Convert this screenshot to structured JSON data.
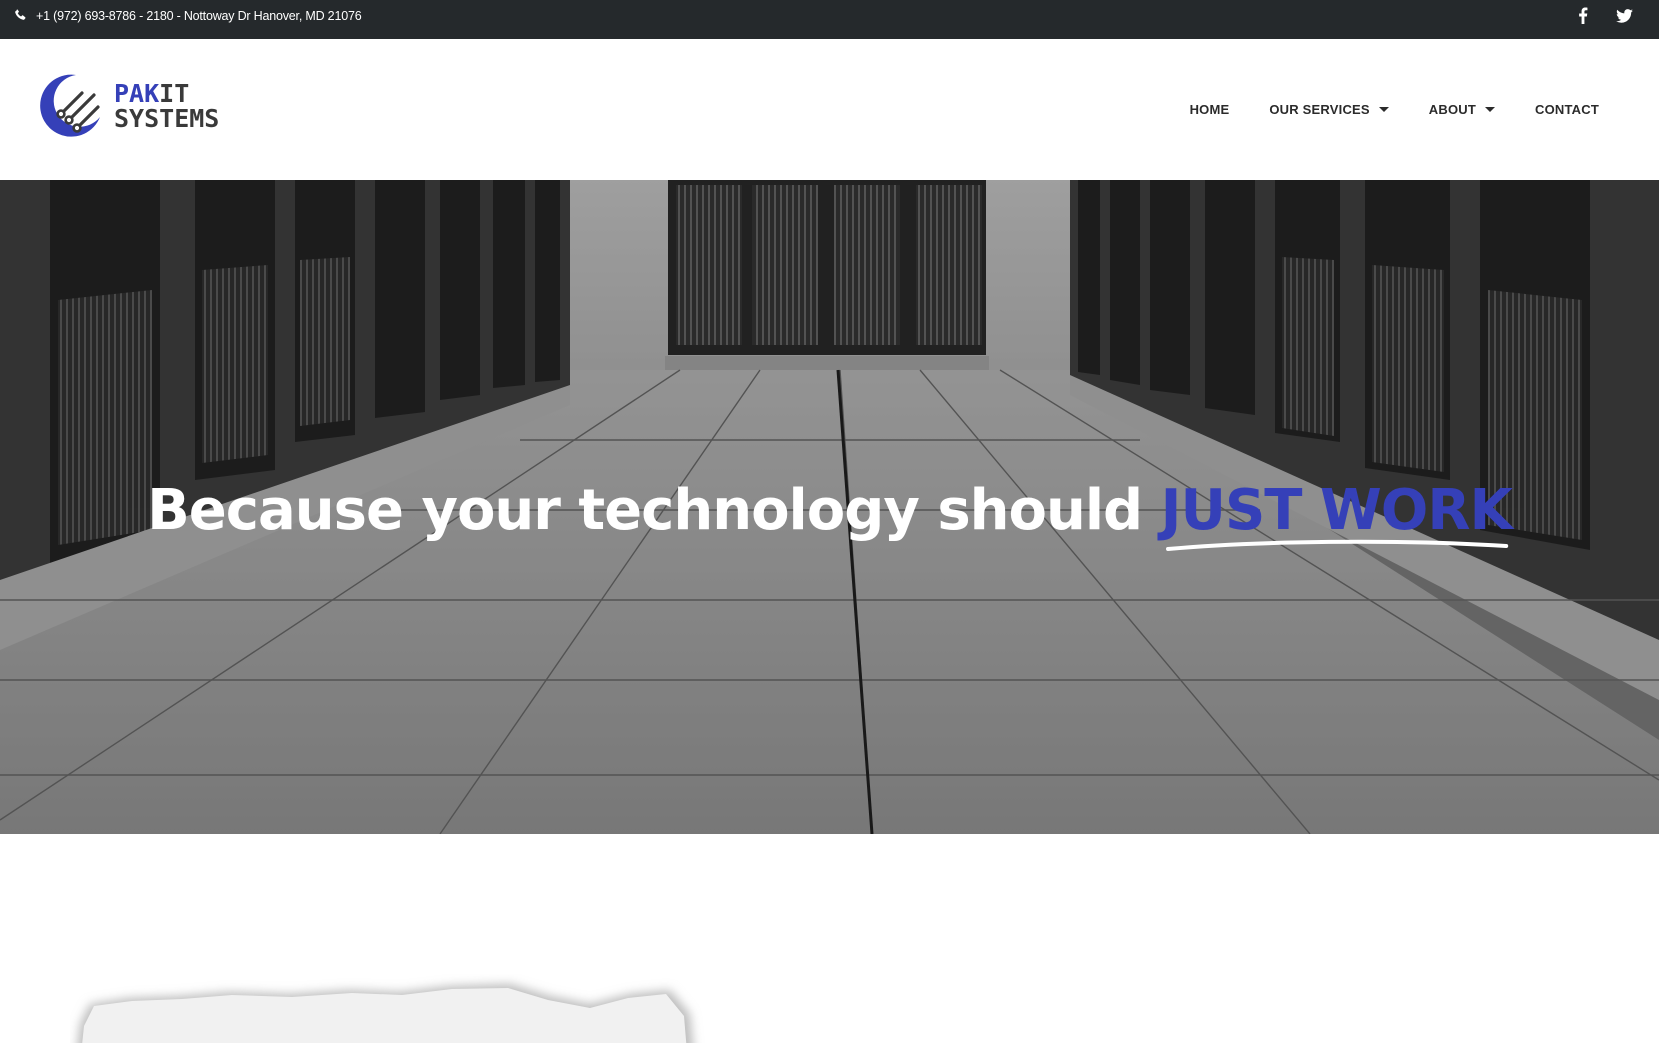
{
  "topbar": {
    "contact_text": "+1 (972) 693-8786 - 2180 - Nottoway Dr Hanover, MD 21076",
    "phone_icon": "phone-icon",
    "social": [
      {
        "name": "facebook",
        "icon": "facebook-icon"
      },
      {
        "name": "twitter",
        "icon": "twitter-icon"
      }
    ]
  },
  "header": {
    "logo": {
      "line1_a": "PAK",
      "line1_b": "IT",
      "line2": "SYSTEMS"
    },
    "nav": [
      {
        "label": "HOME",
        "dropdown": false
      },
      {
        "label": "OUR SERVICES",
        "dropdown": true
      },
      {
        "label": "ABOUT",
        "dropdown": true
      },
      {
        "label": "CONTACT",
        "dropdown": false
      }
    ]
  },
  "hero": {
    "headline_main": "Because your technology should",
    "headline_accent": "JUST WORK"
  },
  "colors": {
    "accent": "#3540b8",
    "topbar_bg": "#25292c",
    "nav_text": "#2b2b2b"
  }
}
